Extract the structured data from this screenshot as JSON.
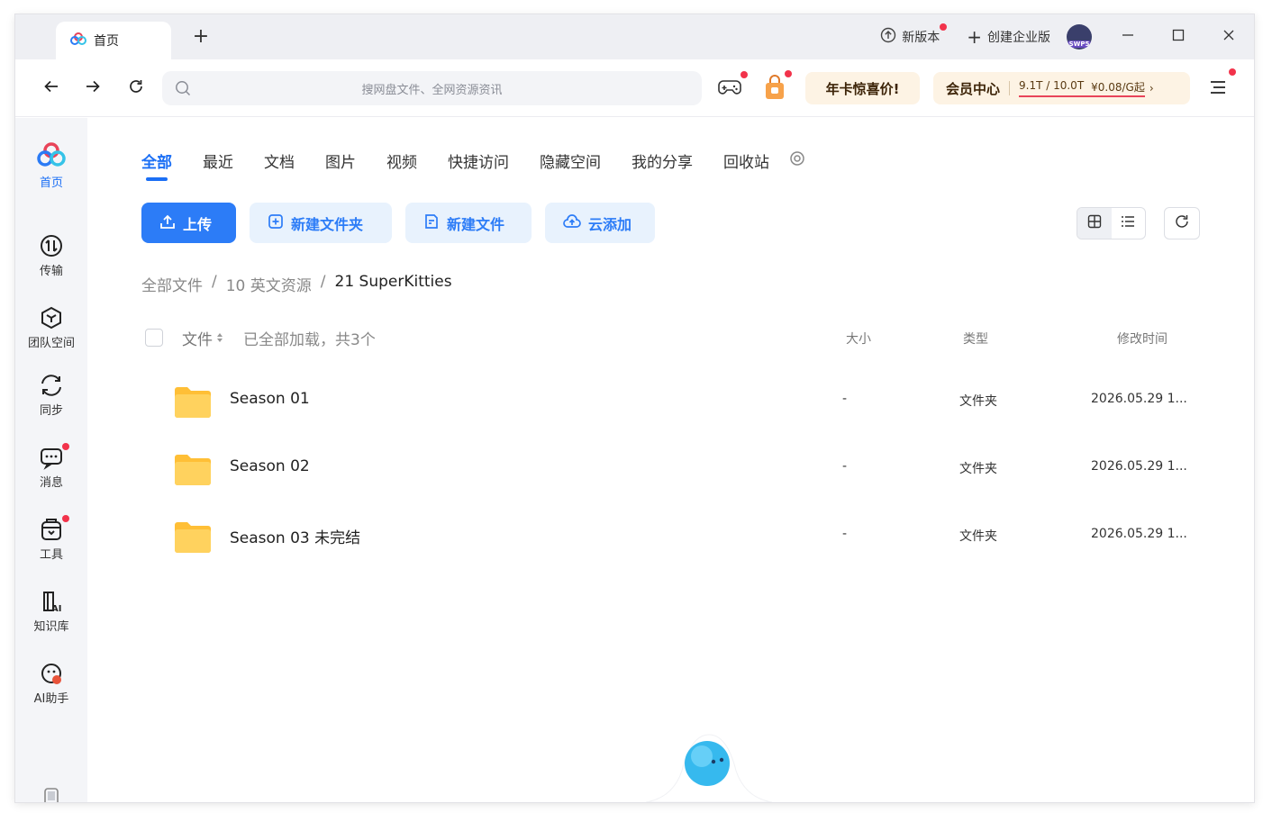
{
  "titlebar": {
    "tab_label": "首页",
    "new_version_label": "新版本",
    "create_enterprise_label": "创建企业版",
    "avatar_text": "SWP5"
  },
  "toolbar": {
    "search_placeholder": "搜网盘文件、全网资源资讯",
    "promo_label": "年卡惊喜价!",
    "vip_label": "会员中心",
    "vip_storage": "9.1T / 10.0T",
    "vip_price": "¥0.08/G起",
    "vip_chevron": "›"
  },
  "sidebar": {
    "items": [
      {
        "label": "首页"
      },
      {
        "label": "传输"
      },
      {
        "label": "团队空间"
      },
      {
        "label": "同步"
      },
      {
        "label": "消息"
      },
      {
        "label": "工具"
      },
      {
        "label": "知识库"
      },
      {
        "label": "AI助手"
      }
    ]
  },
  "categories": [
    "全部",
    "最近",
    "文档",
    "图片",
    "视频",
    "快捷访问",
    "隐藏空间",
    "我的分享",
    "回收站"
  ],
  "actions": {
    "upload": "上传",
    "new_folder": "新建文件夹",
    "new_file": "新建文件",
    "cloud_add": "云添加"
  },
  "breadcrumb": {
    "root": "全部文件",
    "sep1": "/",
    "level1": "10 英文资源",
    "sep2": "/",
    "current": "21 SuperKitties"
  },
  "list": {
    "col_file": "文件",
    "summary": "已全部加载，共3个",
    "col_size": "大小",
    "col_type": "类型",
    "col_time": "修改时间",
    "rows": [
      {
        "name": "Season 01",
        "size": "-",
        "type": "文件夹",
        "time": "2026.05.29 1..."
      },
      {
        "name": "Season 02",
        "size": "-",
        "type": "文件夹",
        "time": "2026.05.29 1..."
      },
      {
        "name": "Season 03 未完结",
        "size": "-",
        "type": "文件夹",
        "time": "2026.05.29 1..."
      }
    ]
  },
  "colors": {
    "accent": "#1b6ff5",
    "primary_button": "#2c7cf7",
    "light_button": "#e8f2fd",
    "folder": "#ffc94d",
    "notify_dot": "#f2334b"
  }
}
